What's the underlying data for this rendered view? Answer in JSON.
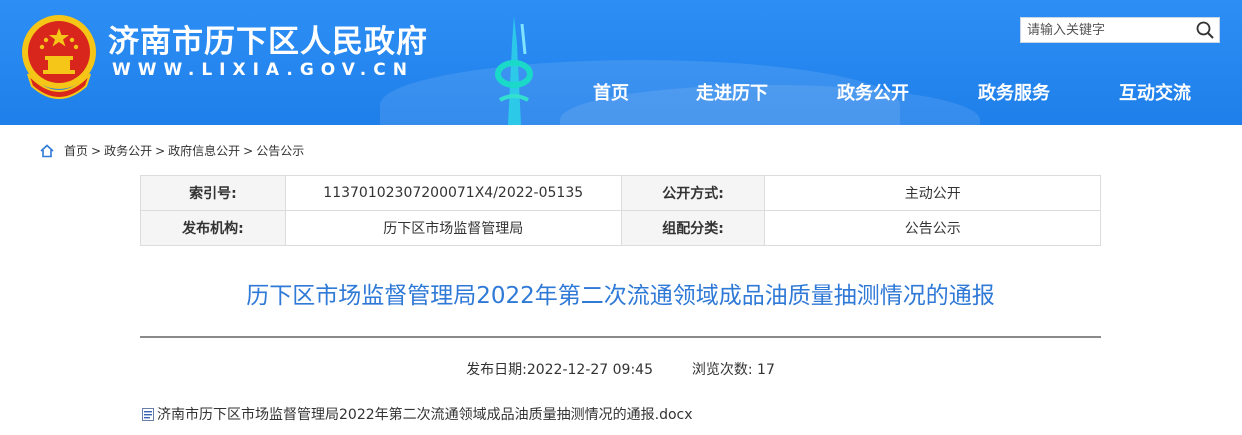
{
  "header": {
    "site_name": "济南市历下区人民政府",
    "site_domain": "WWW.LIXIA.GOV.CN",
    "search_placeholder": "请输入关键字",
    "nav": [
      "首页",
      "走进历下",
      "政务公开",
      "政务服务",
      "互动交流"
    ]
  },
  "breadcrumb": {
    "items": [
      "首页",
      "政务公开",
      "政府信息公开",
      "公告公示"
    ],
    "separator": ">"
  },
  "meta": {
    "index_label": "索引号:",
    "index_value": "11370102307200071X4/2022-05135",
    "open_label": "公开方式:",
    "open_value": "主动公开",
    "org_label": "发布机构:",
    "org_value": "历下区市场监督管理局",
    "category_label": "组配分类:",
    "category_value": "公告公示"
  },
  "article": {
    "title": "历下区市场监督管理局2022年第二次流通领域成品油质量抽测情况的通报",
    "publish_date": "发布日期:2022-12-27 09:45",
    "views": "浏览次数: 17",
    "attachment": "济南市历下区市场监督管理局2022年第二次流通领域成品油质量抽测情况的通报.docx"
  },
  "colors": {
    "header_blue": "#2d8ff5",
    "title_blue": "#2f79d7",
    "emblem_red": "#d9261c",
    "emblem_gold": "#f5c518"
  }
}
